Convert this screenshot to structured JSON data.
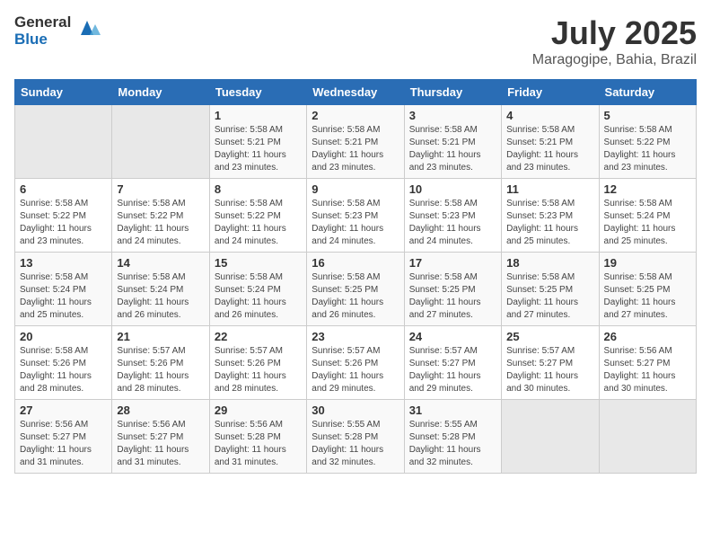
{
  "header": {
    "logo_general": "General",
    "logo_blue": "Blue",
    "month_year": "July 2025",
    "location": "Maragogipe, Bahia, Brazil"
  },
  "calendar": {
    "days_of_week": [
      "Sunday",
      "Monday",
      "Tuesday",
      "Wednesday",
      "Thursday",
      "Friday",
      "Saturday"
    ],
    "weeks": [
      [
        {
          "day": "",
          "info": ""
        },
        {
          "day": "",
          "info": ""
        },
        {
          "day": "1",
          "info": "Sunrise: 5:58 AM\nSunset: 5:21 PM\nDaylight: 11 hours and 23 minutes."
        },
        {
          "day": "2",
          "info": "Sunrise: 5:58 AM\nSunset: 5:21 PM\nDaylight: 11 hours and 23 minutes."
        },
        {
          "day": "3",
          "info": "Sunrise: 5:58 AM\nSunset: 5:21 PM\nDaylight: 11 hours and 23 minutes."
        },
        {
          "day": "4",
          "info": "Sunrise: 5:58 AM\nSunset: 5:21 PM\nDaylight: 11 hours and 23 minutes."
        },
        {
          "day": "5",
          "info": "Sunrise: 5:58 AM\nSunset: 5:22 PM\nDaylight: 11 hours and 23 minutes."
        }
      ],
      [
        {
          "day": "6",
          "info": "Sunrise: 5:58 AM\nSunset: 5:22 PM\nDaylight: 11 hours and 23 minutes."
        },
        {
          "day": "7",
          "info": "Sunrise: 5:58 AM\nSunset: 5:22 PM\nDaylight: 11 hours and 24 minutes."
        },
        {
          "day": "8",
          "info": "Sunrise: 5:58 AM\nSunset: 5:22 PM\nDaylight: 11 hours and 24 minutes."
        },
        {
          "day": "9",
          "info": "Sunrise: 5:58 AM\nSunset: 5:23 PM\nDaylight: 11 hours and 24 minutes."
        },
        {
          "day": "10",
          "info": "Sunrise: 5:58 AM\nSunset: 5:23 PM\nDaylight: 11 hours and 24 minutes."
        },
        {
          "day": "11",
          "info": "Sunrise: 5:58 AM\nSunset: 5:23 PM\nDaylight: 11 hours and 25 minutes."
        },
        {
          "day": "12",
          "info": "Sunrise: 5:58 AM\nSunset: 5:24 PM\nDaylight: 11 hours and 25 minutes."
        }
      ],
      [
        {
          "day": "13",
          "info": "Sunrise: 5:58 AM\nSunset: 5:24 PM\nDaylight: 11 hours and 25 minutes."
        },
        {
          "day": "14",
          "info": "Sunrise: 5:58 AM\nSunset: 5:24 PM\nDaylight: 11 hours and 26 minutes."
        },
        {
          "day": "15",
          "info": "Sunrise: 5:58 AM\nSunset: 5:24 PM\nDaylight: 11 hours and 26 minutes."
        },
        {
          "day": "16",
          "info": "Sunrise: 5:58 AM\nSunset: 5:25 PM\nDaylight: 11 hours and 26 minutes."
        },
        {
          "day": "17",
          "info": "Sunrise: 5:58 AM\nSunset: 5:25 PM\nDaylight: 11 hours and 27 minutes."
        },
        {
          "day": "18",
          "info": "Sunrise: 5:58 AM\nSunset: 5:25 PM\nDaylight: 11 hours and 27 minutes."
        },
        {
          "day": "19",
          "info": "Sunrise: 5:58 AM\nSunset: 5:25 PM\nDaylight: 11 hours and 27 minutes."
        }
      ],
      [
        {
          "day": "20",
          "info": "Sunrise: 5:58 AM\nSunset: 5:26 PM\nDaylight: 11 hours and 28 minutes."
        },
        {
          "day": "21",
          "info": "Sunrise: 5:57 AM\nSunset: 5:26 PM\nDaylight: 11 hours and 28 minutes."
        },
        {
          "day": "22",
          "info": "Sunrise: 5:57 AM\nSunset: 5:26 PM\nDaylight: 11 hours and 28 minutes."
        },
        {
          "day": "23",
          "info": "Sunrise: 5:57 AM\nSunset: 5:26 PM\nDaylight: 11 hours and 29 minutes."
        },
        {
          "day": "24",
          "info": "Sunrise: 5:57 AM\nSunset: 5:27 PM\nDaylight: 11 hours and 29 minutes."
        },
        {
          "day": "25",
          "info": "Sunrise: 5:57 AM\nSunset: 5:27 PM\nDaylight: 11 hours and 30 minutes."
        },
        {
          "day": "26",
          "info": "Sunrise: 5:56 AM\nSunset: 5:27 PM\nDaylight: 11 hours and 30 minutes."
        }
      ],
      [
        {
          "day": "27",
          "info": "Sunrise: 5:56 AM\nSunset: 5:27 PM\nDaylight: 11 hours and 31 minutes."
        },
        {
          "day": "28",
          "info": "Sunrise: 5:56 AM\nSunset: 5:27 PM\nDaylight: 11 hours and 31 minutes."
        },
        {
          "day": "29",
          "info": "Sunrise: 5:56 AM\nSunset: 5:28 PM\nDaylight: 11 hours and 31 minutes."
        },
        {
          "day": "30",
          "info": "Sunrise: 5:55 AM\nSunset: 5:28 PM\nDaylight: 11 hours and 32 minutes."
        },
        {
          "day": "31",
          "info": "Sunrise: 5:55 AM\nSunset: 5:28 PM\nDaylight: 11 hours and 32 minutes."
        },
        {
          "day": "",
          "info": ""
        },
        {
          "day": "",
          "info": ""
        }
      ]
    ]
  }
}
